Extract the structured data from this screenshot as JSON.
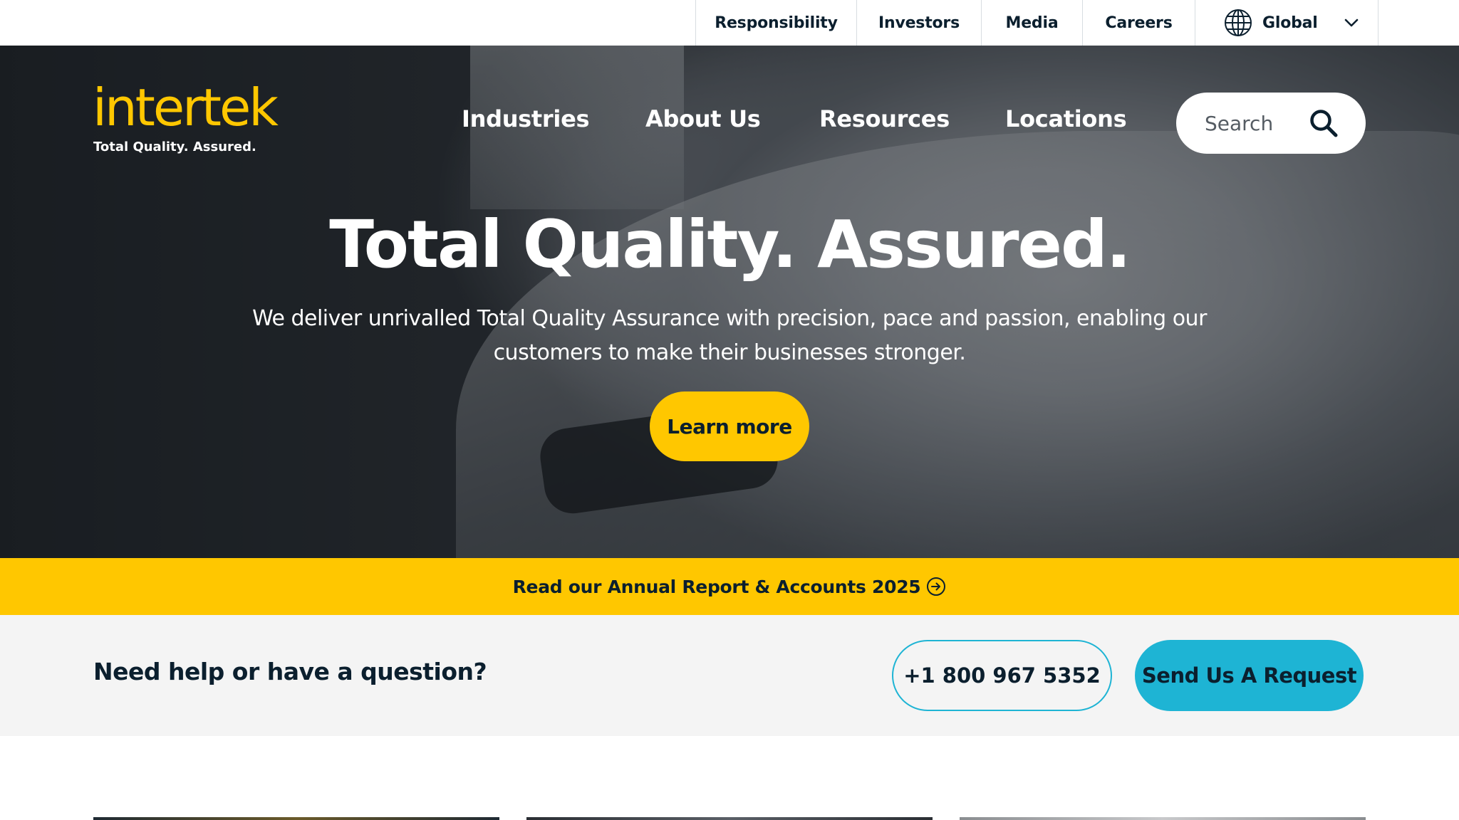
{
  "utility_nav": {
    "items": [
      {
        "label": "Responsibility"
      },
      {
        "label": "Investors"
      },
      {
        "label": "Media"
      },
      {
        "label": "Careers"
      }
    ],
    "region": {
      "label": "Global",
      "icon": "globe-icon",
      "chevron": "chevron-down-icon"
    }
  },
  "brand": {
    "logo_text": "intertek",
    "tagline": "Total Quality. Assured.",
    "color": "#ffc700"
  },
  "main_nav": {
    "items": [
      {
        "label": "Industries"
      },
      {
        "label": "About Us"
      },
      {
        "label": "Resources"
      },
      {
        "label": "Locations"
      }
    ]
  },
  "search": {
    "placeholder": "Search",
    "icon": "search-icon"
  },
  "hero": {
    "title": "Total Quality. Assured.",
    "subtitle": "We deliver unrivalled Total Quality Assurance with precision, pace and passion, enabling our customers to make their businesses stronger.",
    "cta_label": "Learn more"
  },
  "banner": {
    "text": "Read our Annual Report & Accounts 2025",
    "icon": "arrow-circle-right-icon",
    "color": "#ffc700"
  },
  "help": {
    "question": "Need help or have a question?",
    "phone_label": "+1 800 967 5352",
    "request_label": "Send Us A Request",
    "accent_color": "#1eb4d4"
  }
}
